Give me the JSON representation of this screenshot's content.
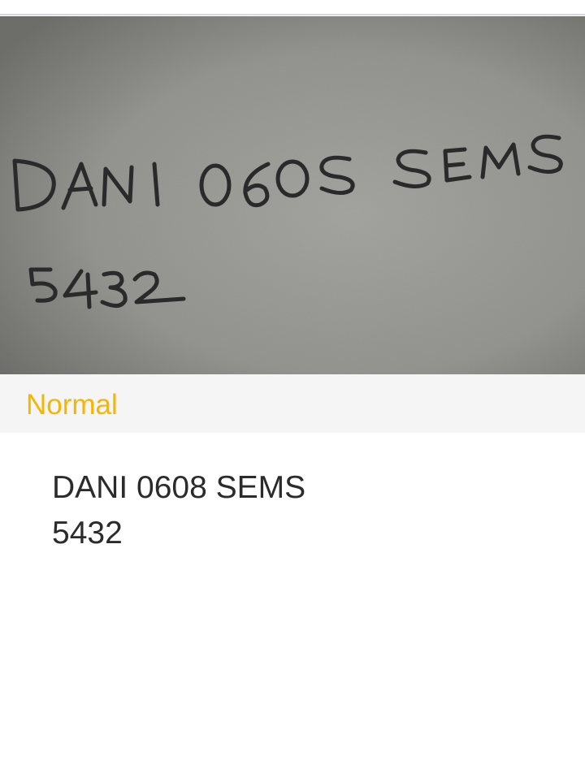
{
  "mode": {
    "label": "Normal",
    "accent_color": "#f6b500"
  },
  "photo": {
    "handwriting_line_1": "DANI 0608 SEMS",
    "handwriting_line_2": "5432"
  },
  "result": {
    "line_1": "DANI 0608 SEMS",
    "line_2": "5432"
  }
}
